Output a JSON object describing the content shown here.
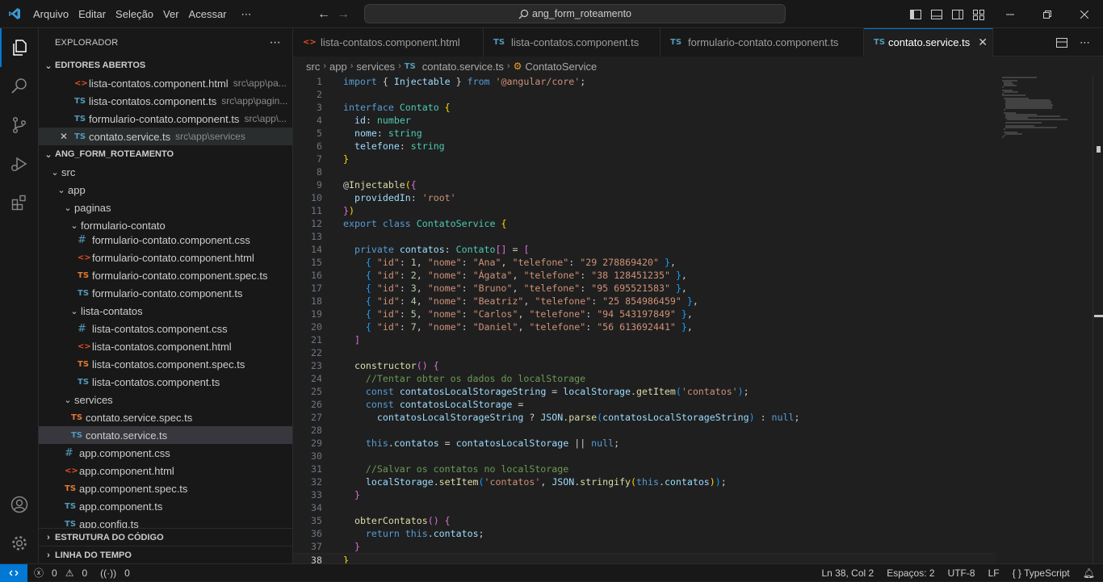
{
  "titlebar": {
    "menu": [
      "Arquivo",
      "Editar",
      "Seleção",
      "Ver",
      "Acessar",
      "⋯"
    ],
    "search_text": "ang_form_roteamento"
  },
  "sidebar": {
    "title": "EXPLORADOR",
    "more": "⋯",
    "open_editors_title": "EDITORES ABERTOS",
    "open_editors": [
      {
        "kind": "html",
        "name": "lista-contatos.component.html",
        "path": "src\\app\\pa..."
      },
      {
        "kind": "ts",
        "name": "lista-contatos.component.ts",
        "path": "src\\app\\pagin..."
      },
      {
        "kind": "ts",
        "name": "formulario-contato.component.ts",
        "path": "src\\app\\..."
      },
      {
        "kind": "ts",
        "name": "contato.service.ts",
        "path": "src\\app\\services"
      }
    ],
    "project_title": "ANG_FORM_ROTEAMENTO",
    "tree": [
      {
        "type": "folder",
        "name": "src"
      },
      {
        "type": "folder",
        "name": "app"
      },
      {
        "type": "folder",
        "name": "paginas"
      },
      {
        "type": "folder",
        "name": "formulario-contato"
      },
      {
        "type": "css",
        "name": "formulario-contato.component.css"
      },
      {
        "type": "html",
        "name": "formulario-contato.component.html"
      },
      {
        "type": "tsspec",
        "name": "formulario-contato.component.spec.ts"
      },
      {
        "type": "ts",
        "name": "formulario-contato.component.ts"
      },
      {
        "type": "folder",
        "name": "lista-contatos"
      },
      {
        "type": "css",
        "name": "lista-contatos.component.css"
      },
      {
        "type": "html",
        "name": "lista-contatos.component.html"
      },
      {
        "type": "tsspec",
        "name": "lista-contatos.component.spec.ts"
      },
      {
        "type": "ts",
        "name": "lista-contatos.component.ts"
      },
      {
        "type": "folder",
        "name": "services"
      },
      {
        "type": "tsspec",
        "name": "contato.service.spec.ts"
      },
      {
        "type": "ts",
        "name": "contato.service.ts"
      },
      {
        "type": "css",
        "name": "app.component.css"
      },
      {
        "type": "html",
        "name": "app.component.html"
      },
      {
        "type": "tsspec",
        "name": "app.component.spec.ts"
      },
      {
        "type": "ts",
        "name": "app.component.ts"
      },
      {
        "type": "ts",
        "name": "app.config.ts"
      }
    ],
    "outline_title": "ESTRUTURA DO CÓDIGO",
    "timeline_title": "LINHA DO TEMPO"
  },
  "tabs": [
    {
      "kind": "html",
      "label": "lista-contatos.component.html",
      "active": false
    },
    {
      "kind": "ts",
      "label": "lista-contatos.component.ts",
      "active": false
    },
    {
      "kind": "ts",
      "label": "formulario-contato.component.ts",
      "active": false
    },
    {
      "kind": "ts",
      "label": "contato.service.ts",
      "active": true
    }
  ],
  "breadcrumb": [
    "src",
    "app",
    "services",
    "contato.service.ts",
    "ContatoService"
  ],
  "editor": {
    "current_line": 38,
    "lines": [
      [
        [
          "k",
          "import"
        ],
        [
          "p",
          " { "
        ],
        [
          "v",
          "Injectable"
        ],
        [
          "p",
          " } "
        ],
        [
          "k",
          "from"
        ],
        [
          "p",
          " "
        ],
        [
          "s",
          "'@angular/core'"
        ],
        [
          "p",
          ";"
        ]
      ],
      [],
      [
        [
          "k",
          "interface"
        ],
        [
          "p",
          " "
        ],
        [
          "t",
          "Contato"
        ],
        [
          "p",
          " "
        ],
        [
          "b1",
          "{"
        ]
      ],
      [
        [
          "p",
          "  "
        ],
        [
          "v",
          "id"
        ],
        [
          "p",
          ": "
        ],
        [
          "t",
          "number"
        ]
      ],
      [
        [
          "p",
          "  "
        ],
        [
          "v",
          "nome"
        ],
        [
          "p",
          ": "
        ],
        [
          "t",
          "string"
        ]
      ],
      [
        [
          "p",
          "  "
        ],
        [
          "v",
          "telefone"
        ],
        [
          "p",
          ": "
        ],
        [
          "t",
          "string"
        ]
      ],
      [
        [
          "b1",
          "}"
        ]
      ],
      [],
      [
        [
          "p",
          "@"
        ],
        [
          "f",
          "Injectable"
        ],
        [
          "b1",
          "("
        ],
        [
          "b2",
          "{"
        ]
      ],
      [
        [
          "p",
          "  "
        ],
        [
          "v",
          "providedIn"
        ],
        [
          "p",
          ": "
        ],
        [
          "s",
          "'root'"
        ]
      ],
      [
        [
          "b2",
          "}"
        ],
        [
          "b1",
          ")"
        ]
      ],
      [
        [
          "k",
          "export"
        ],
        [
          "p",
          " "
        ],
        [
          "k",
          "class"
        ],
        [
          "p",
          " "
        ],
        [
          "t",
          "ContatoService"
        ],
        [
          "p",
          " "
        ],
        [
          "b1",
          "{"
        ]
      ],
      [],
      [
        [
          "p",
          "  "
        ],
        [
          "k",
          "private"
        ],
        [
          "p",
          " "
        ],
        [
          "v",
          "contatos"
        ],
        [
          "p",
          ": "
        ],
        [
          "t",
          "Contato"
        ],
        [
          "b2",
          "[]"
        ],
        [
          "p",
          " = "
        ],
        [
          "b2",
          "["
        ]
      ],
      [
        [
          "p",
          "    "
        ],
        [
          "b3",
          "{"
        ],
        [
          "p",
          " "
        ],
        [
          "s",
          "\"id\""
        ],
        [
          "p",
          ": "
        ],
        [
          "n",
          "1"
        ],
        [
          "p",
          ", "
        ],
        [
          "s",
          "\"nome\""
        ],
        [
          "p",
          ": "
        ],
        [
          "s",
          "\"Ana\""
        ],
        [
          "p",
          ", "
        ],
        [
          "s",
          "\"telefone\""
        ],
        [
          "p",
          ": "
        ],
        [
          "s",
          "\"29 278869420\""
        ],
        [
          "p",
          " "
        ],
        [
          "b3",
          "}"
        ],
        [
          "p",
          ","
        ]
      ],
      [
        [
          "p",
          "    "
        ],
        [
          "b3",
          "{"
        ],
        [
          "p",
          " "
        ],
        [
          "s",
          "\"id\""
        ],
        [
          "p",
          ": "
        ],
        [
          "n",
          "2"
        ],
        [
          "p",
          ", "
        ],
        [
          "s",
          "\"nome\""
        ],
        [
          "p",
          ": "
        ],
        [
          "s",
          "\"Ágata\""
        ],
        [
          "p",
          ", "
        ],
        [
          "s",
          "\"telefone\""
        ],
        [
          "p",
          ": "
        ],
        [
          "s",
          "\"38 128451235\""
        ],
        [
          "p",
          " "
        ],
        [
          "b3",
          "}"
        ],
        [
          "p",
          ","
        ]
      ],
      [
        [
          "p",
          "    "
        ],
        [
          "b3",
          "{"
        ],
        [
          "p",
          " "
        ],
        [
          "s",
          "\"id\""
        ],
        [
          "p",
          ": "
        ],
        [
          "n",
          "3"
        ],
        [
          "p",
          ", "
        ],
        [
          "s",
          "\"nome\""
        ],
        [
          "p",
          ": "
        ],
        [
          "s",
          "\"Bruno\""
        ],
        [
          "p",
          ", "
        ],
        [
          "s",
          "\"telefone\""
        ],
        [
          "p",
          ": "
        ],
        [
          "s",
          "\"95 695521583\""
        ],
        [
          "p",
          " "
        ],
        [
          "b3",
          "}"
        ],
        [
          "p",
          ","
        ]
      ],
      [
        [
          "p",
          "    "
        ],
        [
          "b3",
          "{"
        ],
        [
          "p",
          " "
        ],
        [
          "s",
          "\"id\""
        ],
        [
          "p",
          ": "
        ],
        [
          "n",
          "4"
        ],
        [
          "p",
          ", "
        ],
        [
          "s",
          "\"nome\""
        ],
        [
          "p",
          ": "
        ],
        [
          "s",
          "\"Beatriz\""
        ],
        [
          "p",
          ", "
        ],
        [
          "s",
          "\"telefone\""
        ],
        [
          "p",
          ": "
        ],
        [
          "s",
          "\"25 854986459\""
        ],
        [
          "p",
          " "
        ],
        [
          "b3",
          "}"
        ],
        [
          "p",
          ","
        ]
      ],
      [
        [
          "p",
          "    "
        ],
        [
          "b3",
          "{"
        ],
        [
          "p",
          " "
        ],
        [
          "s",
          "\"id\""
        ],
        [
          "p",
          ": "
        ],
        [
          "n",
          "5"
        ],
        [
          "p",
          ", "
        ],
        [
          "s",
          "\"nome\""
        ],
        [
          "p",
          ": "
        ],
        [
          "s",
          "\"Carlos\""
        ],
        [
          "p",
          ", "
        ],
        [
          "s",
          "\"telefone\""
        ],
        [
          "p",
          ": "
        ],
        [
          "s",
          "\"94 543197849\""
        ],
        [
          "p",
          " "
        ],
        [
          "b3",
          "}"
        ],
        [
          "p",
          ","
        ]
      ],
      [
        [
          "p",
          "    "
        ],
        [
          "b3",
          "{"
        ],
        [
          "p",
          " "
        ],
        [
          "s",
          "\"id\""
        ],
        [
          "p",
          ": "
        ],
        [
          "n",
          "7"
        ],
        [
          "p",
          ", "
        ],
        [
          "s",
          "\"nome\""
        ],
        [
          "p",
          ": "
        ],
        [
          "s",
          "\"Daniel\""
        ],
        [
          "p",
          ", "
        ],
        [
          "s",
          "\"telefone\""
        ],
        [
          "p",
          ": "
        ],
        [
          "s",
          "\"56 613692441\""
        ],
        [
          "p",
          " "
        ],
        [
          "b3",
          "}"
        ],
        [
          "p",
          ","
        ]
      ],
      [
        [
          "p",
          "  "
        ],
        [
          "b2",
          "]"
        ]
      ],
      [],
      [
        [
          "p",
          "  "
        ],
        [
          "f",
          "constructor"
        ],
        [
          "b2",
          "()"
        ],
        [
          "p",
          " "
        ],
        [
          "b2",
          "{"
        ]
      ],
      [
        [
          "p",
          "    "
        ],
        [
          "c",
          "//Tentar obter os dados do localStorage"
        ]
      ],
      [
        [
          "p",
          "    "
        ],
        [
          "k",
          "const"
        ],
        [
          "p",
          " "
        ],
        [
          "v",
          "contatosLocalStorageString"
        ],
        [
          "p",
          " = "
        ],
        [
          "v",
          "localStorage"
        ],
        [
          "p",
          "."
        ],
        [
          "f",
          "getItem"
        ],
        [
          "b3",
          "("
        ],
        [
          "s",
          "'contatos'"
        ],
        [
          "b3",
          ")"
        ],
        [
          "p",
          ";"
        ]
      ],
      [
        [
          "p",
          "    "
        ],
        [
          "k",
          "const"
        ],
        [
          "p",
          " "
        ],
        [
          "v",
          "contatosLocalStorage"
        ],
        [
          "p",
          " ="
        ]
      ],
      [
        [
          "p",
          "      "
        ],
        [
          "v",
          "contatosLocalStorageString"
        ],
        [
          "p",
          " ? "
        ],
        [
          "v",
          "JSON"
        ],
        [
          "p",
          "."
        ],
        [
          "f",
          "parse"
        ],
        [
          "b3",
          "("
        ],
        [
          "v",
          "contatosLocalStorageString"
        ],
        [
          "b3",
          ")"
        ],
        [
          "p",
          " : "
        ],
        [
          "k",
          "null"
        ],
        [
          "p",
          ";"
        ]
      ],
      [],
      [
        [
          "p",
          "    "
        ],
        [
          "k",
          "this"
        ],
        [
          "p",
          "."
        ],
        [
          "v",
          "contatos"
        ],
        [
          "p",
          " = "
        ],
        [
          "v",
          "contatosLocalStorage"
        ],
        [
          "p",
          " || "
        ],
        [
          "k",
          "null"
        ],
        [
          "p",
          ";"
        ]
      ],
      [],
      [
        [
          "p",
          "    "
        ],
        [
          "c",
          "//Salvar os contatos no localStorage"
        ]
      ],
      [
        [
          "p",
          "    "
        ],
        [
          "v",
          "localStorage"
        ],
        [
          "p",
          "."
        ],
        [
          "f",
          "setItem"
        ],
        [
          "b3",
          "("
        ],
        [
          "s",
          "'contatos'"
        ],
        [
          "p",
          ", "
        ],
        [
          "v",
          "JSON"
        ],
        [
          "p",
          "."
        ],
        [
          "f",
          "stringify"
        ],
        [
          "b1",
          "("
        ],
        [
          "k",
          "this"
        ],
        [
          "p",
          "."
        ],
        [
          "v",
          "contatos"
        ],
        [
          "b1",
          ")"
        ],
        [
          "b3",
          ")"
        ],
        [
          "p",
          ";"
        ]
      ],
      [
        [
          "p",
          "  "
        ],
        [
          "b2",
          "}"
        ]
      ],
      [],
      [
        [
          "p",
          "  "
        ],
        [
          "f",
          "obterContatos"
        ],
        [
          "b2",
          "()"
        ],
        [
          "p",
          " "
        ],
        [
          "b2",
          "{"
        ]
      ],
      [
        [
          "p",
          "    "
        ],
        [
          "k",
          "return"
        ],
        [
          "p",
          " "
        ],
        [
          "k",
          "this"
        ],
        [
          "p",
          "."
        ],
        [
          "v",
          "contatos"
        ],
        [
          "p",
          ";"
        ]
      ],
      [
        [
          "p",
          "  "
        ],
        [
          "b2",
          "}"
        ]
      ],
      [
        [
          "b1",
          "}"
        ]
      ]
    ]
  },
  "colors": {
    "k": "#569cd6",
    "v": "#9cdcfe",
    "s": "#ce9178",
    "n": "#b5cea8",
    "t": "#4ec9b0",
    "f": "#dcdcaa",
    "c": "#6a9955",
    "p": "#cccccc",
    "b1": "#ffd700",
    "b2": "#da70d6",
    "b3": "#179fff",
    "accent": "#0078d4"
  },
  "statusbar": {
    "errors": "0",
    "warnings": "0",
    "ports": "0",
    "position": "Ln 38, Col 2",
    "spaces": "Espaços: 2",
    "encoding": "UTF-8",
    "eol": "LF",
    "language": "TypeScript"
  }
}
